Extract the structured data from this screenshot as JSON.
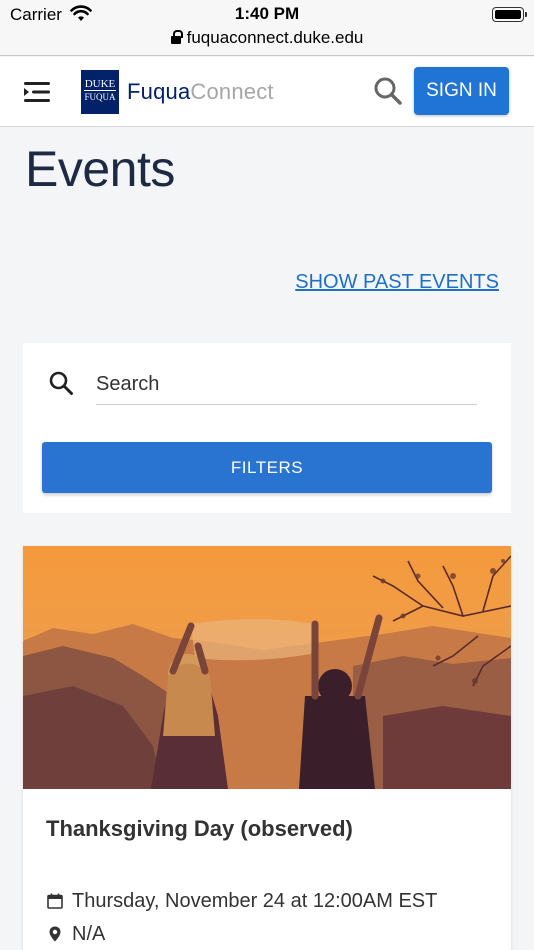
{
  "status_bar": {
    "carrier": "Carrier",
    "time": "1:40 PM",
    "url": "fuquaconnect.duke.edu"
  },
  "header": {
    "logo_line1": "DUKE",
    "logo_line2": "FUQUA",
    "brand_fuqua": "Fuqua",
    "brand_connect": "Connect",
    "sign_in_label": "SIGN IN",
    "brand_color": "#012169",
    "accent_color": "#1f74d6"
  },
  "page": {
    "title": "Events",
    "show_past_label": "SHOW PAST EVENTS"
  },
  "search": {
    "placeholder": "Search",
    "value": "",
    "filters_label": "FILTERS"
  },
  "events": [
    {
      "title": "Thanksgiving Day (observed)",
      "date": "Thursday, November 24 at 12:00AM EST",
      "location": "N/A",
      "image_tint": "#f29a3a"
    }
  ],
  "icons": {
    "menu": "menu-icon",
    "search": "search-icon",
    "calendar": "calendar-icon",
    "location": "location-pin-icon",
    "wifi": "wifi-icon",
    "battery": "battery-icon",
    "lock": "lock-icon"
  }
}
